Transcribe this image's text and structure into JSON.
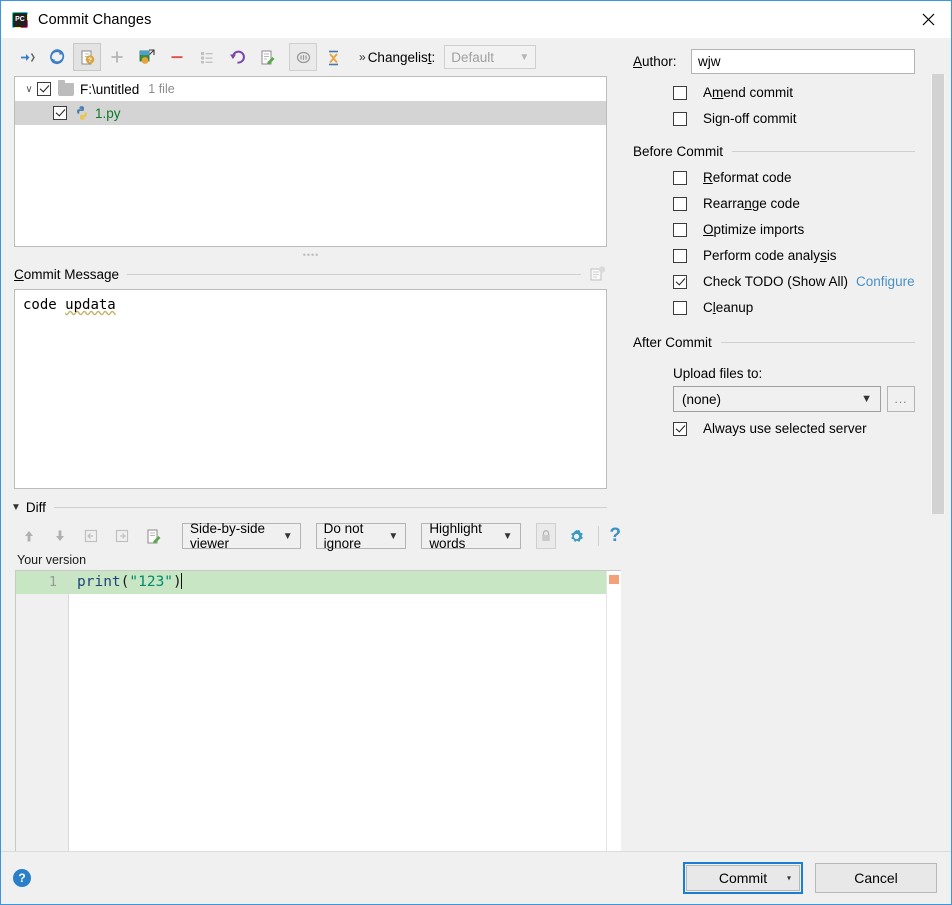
{
  "window": {
    "title": "Commit Changes",
    "app_icon": "pycharm-logo-icon",
    "close_icon": "close-icon"
  },
  "toolbar": {
    "buttons": [
      {
        "name": "show-diff-icon",
        "tooltip": "Show Diff"
      },
      {
        "name": "refresh-icon",
        "tooltip": "Refresh"
      },
      {
        "name": "group-by-icon",
        "tooltip": "Group By"
      },
      {
        "name": "add-icon",
        "tooltip": "Add"
      },
      {
        "name": "move-to-changelist-icon",
        "tooltip": "Move to Another Changelist"
      },
      {
        "name": "delete-icon",
        "tooltip": "Delete"
      },
      {
        "name": "list-icon",
        "tooltip": "List"
      },
      {
        "name": "revert-icon",
        "tooltip": "Revert"
      },
      {
        "name": "edit-source-icon",
        "tooltip": "Edit Source"
      },
      {
        "name": "show-ignored-icon",
        "tooltip": "Show Ignored Files"
      },
      {
        "name": "expand-collapse-icon",
        "tooltip": "Expand / Collapse All"
      }
    ],
    "changelist_chevron": "»",
    "changelist_label": "Changelist:",
    "changelist_label_pre": "Changelis",
    "changelist_label_mnemonic": "t",
    "changelist_label_post": ":",
    "changelist_value": "Default"
  },
  "file_tree": {
    "rows": [
      {
        "type": "folder",
        "expander": "∨",
        "checked": true,
        "icon": "folder-icon",
        "label": "F:\\untitled",
        "count": "1 file",
        "selected": false
      },
      {
        "type": "file",
        "checked": true,
        "icon": "python-file-icon",
        "label": "1.py",
        "selected": true
      }
    ]
  },
  "commit_message": {
    "title_pre": "",
    "title_mnemonic": "C",
    "title_post": "ommit Message",
    "title": "Commit Message",
    "icon": "message-history-icon",
    "value_start": "code ",
    "value_misspelled": "updata",
    "value": "code updata"
  },
  "diff": {
    "section_label": "Diff",
    "caret": "▼",
    "toolbar_icons": [
      {
        "name": "previous-difference-icon"
      },
      {
        "name": "next-difference-icon"
      },
      {
        "name": "apply-left-icon"
      },
      {
        "name": "apply-right-icon"
      },
      {
        "name": "jump-to-source-icon"
      }
    ],
    "viewer_mode": "Side-by-side viewer",
    "ignore_mode": "Do not ignore",
    "highlight_mode": "Highlight words",
    "lock_icon": "lock-icon",
    "settings_icon": "gear-icon",
    "help_icon": "help-question-icon",
    "pane_label": "Your version",
    "code": {
      "line_number": "1",
      "tokens": [
        {
          "text": "print",
          "kind": "fn"
        },
        {
          "text": "(",
          "kind": "paren"
        },
        {
          "text": "\"123\"",
          "kind": "str"
        },
        {
          "text": ")",
          "kind": "paren"
        }
      ],
      "text": "print(\"123\")"
    }
  },
  "options": {
    "author_label_pre": "",
    "author_label_mnemonic": "A",
    "author_label_post": "uthor:",
    "author_label": "Author:",
    "author_value": "wjw",
    "author_placeholder": "",
    "top_checkboxes": [
      {
        "name": "amend-commit",
        "label_pre": "A",
        "label_mnemonic": "m",
        "label_post": "end commit",
        "label": "Amend commit",
        "checked": false
      },
      {
        "name": "sign-off-commit",
        "label_pre": "Si",
        "label_mnemonic": "g",
        "label_post": "n-off commit",
        "label": "Sign-off commit",
        "checked": false
      }
    ],
    "before_commit": {
      "title": "Before Commit",
      "items": [
        {
          "name": "reformat-code",
          "label_pre": "",
          "label_mnemonic": "R",
          "label_post": "eformat code",
          "label": "Reformat code",
          "checked": false
        },
        {
          "name": "rearrange-code",
          "label_pre": "Rearra",
          "label_mnemonic": "n",
          "label_post": "ge code",
          "label": "Rearrange code",
          "checked": false
        },
        {
          "name": "optimize-imports",
          "label_pre": "",
          "label_mnemonic": "O",
          "label_post": "ptimize imports",
          "label": "Optimize imports",
          "checked": false
        },
        {
          "name": "perform-code-analysis",
          "label_pre": "Perform code analy",
          "label_mnemonic": "s",
          "label_post": "is",
          "label": "Perform code analysis",
          "checked": false
        },
        {
          "name": "check-todo",
          "label_pre": "Check TODO (Show All)",
          "label_mnemonic": "",
          "label_post": "",
          "label": "Check TODO (Show All)",
          "checked": true,
          "link": "Configure"
        },
        {
          "name": "cleanup",
          "label_pre": "C",
          "label_mnemonic": "l",
          "label_post": "eanup",
          "label": "Cleanup",
          "checked": false
        }
      ]
    },
    "after_commit": {
      "title": "After Commit",
      "upload_label": "Upload files to:",
      "upload_value": "(none)",
      "browse_label": "...",
      "always_use_server": {
        "name": "always-use-selected-server",
        "label": "Always use selected server",
        "checked": true
      }
    }
  },
  "footer": {
    "help_label": "?",
    "commit_label": "Commit",
    "commit_dropdown": "▾",
    "cancel_label": "Cancel"
  },
  "colors": {
    "accent_blue": "#3a96dd",
    "focus_blue": "#1a7fd4",
    "link_blue": "#4a90c4",
    "added_file_green": "#0a7a28",
    "diff_added_bg": "#c8e6c4",
    "dialog_bg": "#f0f0f0"
  }
}
